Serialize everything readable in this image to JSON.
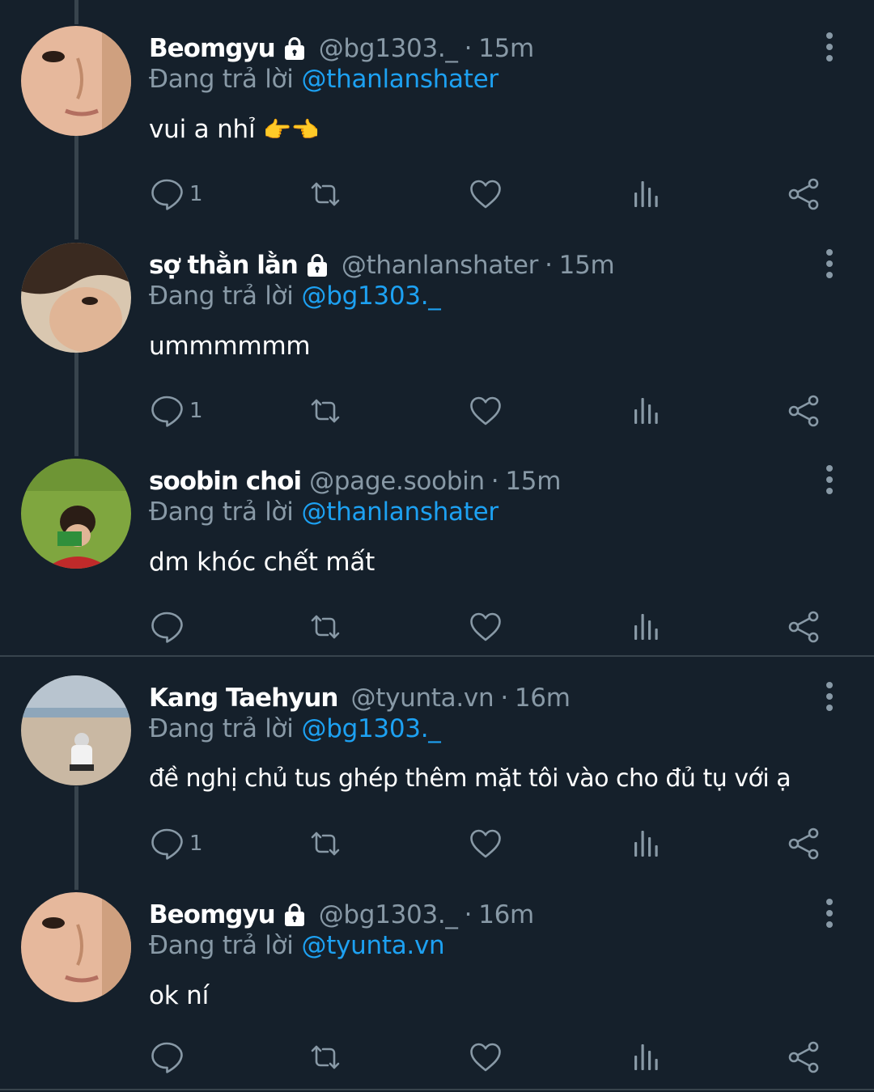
{
  "reply_prefix": "Đang trả lời",
  "colors": {
    "background": "#15202b",
    "accent": "#1da1f2",
    "muted": "#8899a6",
    "divider": "#38444d"
  },
  "icons": {
    "reply": "comment-icon",
    "retweet": "retweet-icon",
    "like": "heart-icon",
    "analytics": "analytics-icon",
    "share": "share-icon",
    "more": "more-vertical-icon",
    "protected": "lock-icon"
  },
  "tweets": [
    {
      "name": "Beomgyu",
      "handle": "@bg1303._",
      "time": "15m",
      "reply_to": "@thanlanshater",
      "text": "vui a nhỉ",
      "emoji": "👉👈",
      "reply_count": "1",
      "protected": true
    },
    {
      "name": "sợ thằn lằn",
      "handle": "@thanlanshater",
      "time": "15m",
      "reply_to": "@bg1303._",
      "text": "ummmmmm",
      "reply_count": "1",
      "protected": true
    },
    {
      "name": "soobin choi",
      "handle": "@page.soobin",
      "time": "15m",
      "reply_to": "@thanlanshater",
      "text": "dm khóc chết mất",
      "reply_count": "",
      "protected": false
    },
    {
      "name": "Kang Taehyun",
      "handle": "@tyunta.vn",
      "time": "16m",
      "reply_to": "@bg1303._",
      "text": "đề nghị chủ tus ghép thêm mặt tôi vào cho đủ tụ với ạ",
      "reply_count": "1",
      "protected": false
    },
    {
      "name": "Beomgyu",
      "handle": "@bg1303._",
      "time": "16m",
      "reply_to": "@tyunta.vn",
      "text": "ok ní",
      "reply_count": "",
      "protected": true
    }
  ]
}
